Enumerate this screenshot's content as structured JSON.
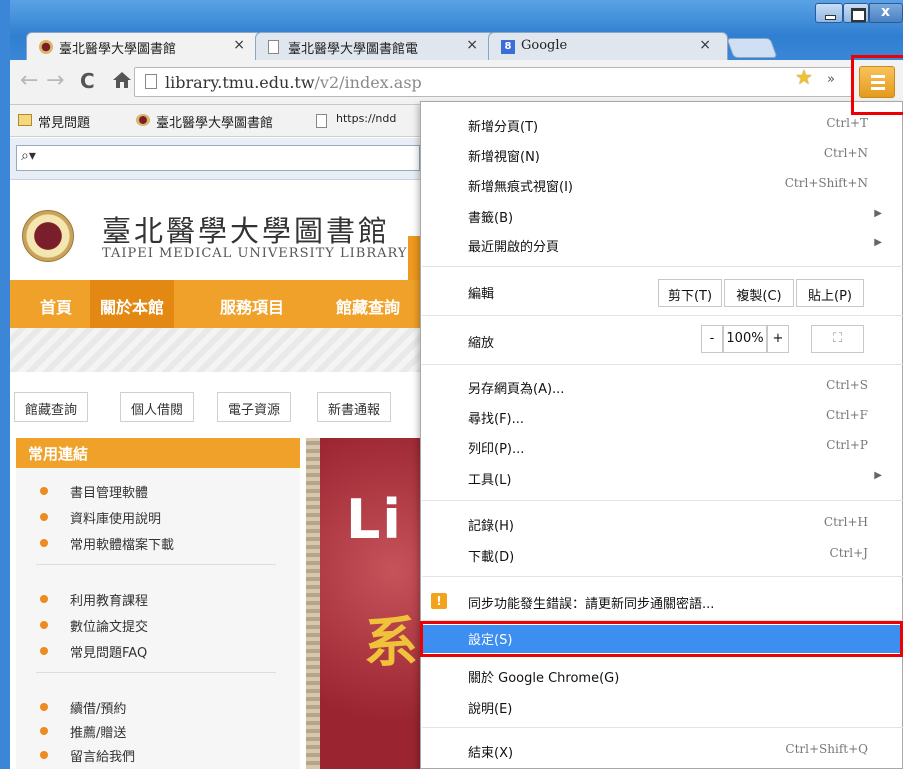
{
  "browser": {
    "tabs": [
      {
        "title": "臺北醫學大學圖書館",
        "close": "×",
        "active": true
      },
      {
        "title": "臺北醫學大學圖書館電",
        "close": "×",
        "active": false
      },
      {
        "title": "Google",
        "close": "×",
        "active": false
      }
    ],
    "window_controls": {
      "close": "x"
    },
    "address": {
      "host": "library.tmu.edu.tw",
      "path": "/v2/index.asp"
    },
    "bookmarks": [
      "常見問題",
      "臺北醫學大學圖書館",
      "https://ndd"
    ],
    "icons": {
      "back": "back-arrow-icon",
      "forward": "forward-arrow-icon",
      "reload": "reload-icon",
      "home": "home-icon",
      "star": "star-icon",
      "menu": "hamburger-menu-icon",
      "extension": "extension-overflow-icon",
      "search": "magnifier-icon"
    },
    "glyphs": {
      "back": "←",
      "forward": "→",
      "reload": "C",
      "home": "🏠",
      "star": "★",
      "extension": "»",
      "search": "⌕▾"
    }
  },
  "page": {
    "site_title": "臺北醫學大學圖書館",
    "site_subtitle": "TAIPEI MEDICAL UNIVERSITY LIBRARY",
    "nav": [
      "首頁",
      "關於本館",
      "服務項目",
      "館藏查詢"
    ],
    "subnav": [
      "館藏查詢",
      "個人借閱",
      "電子資源",
      "新書通報"
    ],
    "sidebar": {
      "heading": "常用連結",
      "links": [
        "書目管理軟體",
        "資料庫使用說明",
        "常用軟體檔案下載",
        "利用教育課程",
        "數位論文提交",
        "常見問題FAQ",
        "續借/預約",
        "推薦/贈送",
        "留言給我們"
      ]
    },
    "banner": {
      "text_1": "Li",
      "text_2": "系"
    }
  },
  "menu": {
    "items": {
      "new_tab": {
        "label": "新增分頁(T)",
        "shortcut": "Ctrl+T"
      },
      "new_window": {
        "label": "新增視窗(N)",
        "shortcut": "Ctrl+N"
      },
      "incognito": {
        "label": "新增無痕式視窗(I)",
        "shortcut": "Ctrl+Shift+N"
      },
      "bookmarks": {
        "label": "書籤(B)"
      },
      "recent_tabs": {
        "label": "最近開啟的分頁"
      },
      "edit": {
        "label": "編輯",
        "cut": "剪下(T)",
        "copy": "複製(C)",
        "paste": "貼上(P)"
      },
      "zoom": {
        "label": "縮放",
        "minus": "-",
        "value": "100%",
        "plus": "+",
        "fullscreen": "⛶"
      },
      "save_as": {
        "label": "另存網頁為(A)...",
        "shortcut": "Ctrl+S"
      },
      "find": {
        "label": "尋找(F)...",
        "shortcut": "Ctrl+F"
      },
      "print": {
        "label": "列印(P)...",
        "shortcut": "Ctrl+P"
      },
      "tools": {
        "label": "工具(L)"
      },
      "history": {
        "label": "記錄(H)",
        "shortcut": "Ctrl+H"
      },
      "downloads": {
        "label": "下載(D)",
        "shortcut": "Ctrl+J"
      },
      "sync_error": {
        "label": "同步功能發生錯誤：請更新同步通關密語...",
        "icon": "!"
      },
      "settings": {
        "label": "設定(S)"
      },
      "about": {
        "label": "關於 Google Chrome(G)"
      },
      "help": {
        "label": "說明(E)"
      },
      "exit": {
        "label": "結束(X)",
        "shortcut": "Ctrl+Shift+Q"
      }
    },
    "submenu_arrow": "▶"
  },
  "colors": {
    "accent_orange": "#f0a129",
    "menu_highlight": "#3c8ef0",
    "annotation_red": "#ee0000"
  }
}
